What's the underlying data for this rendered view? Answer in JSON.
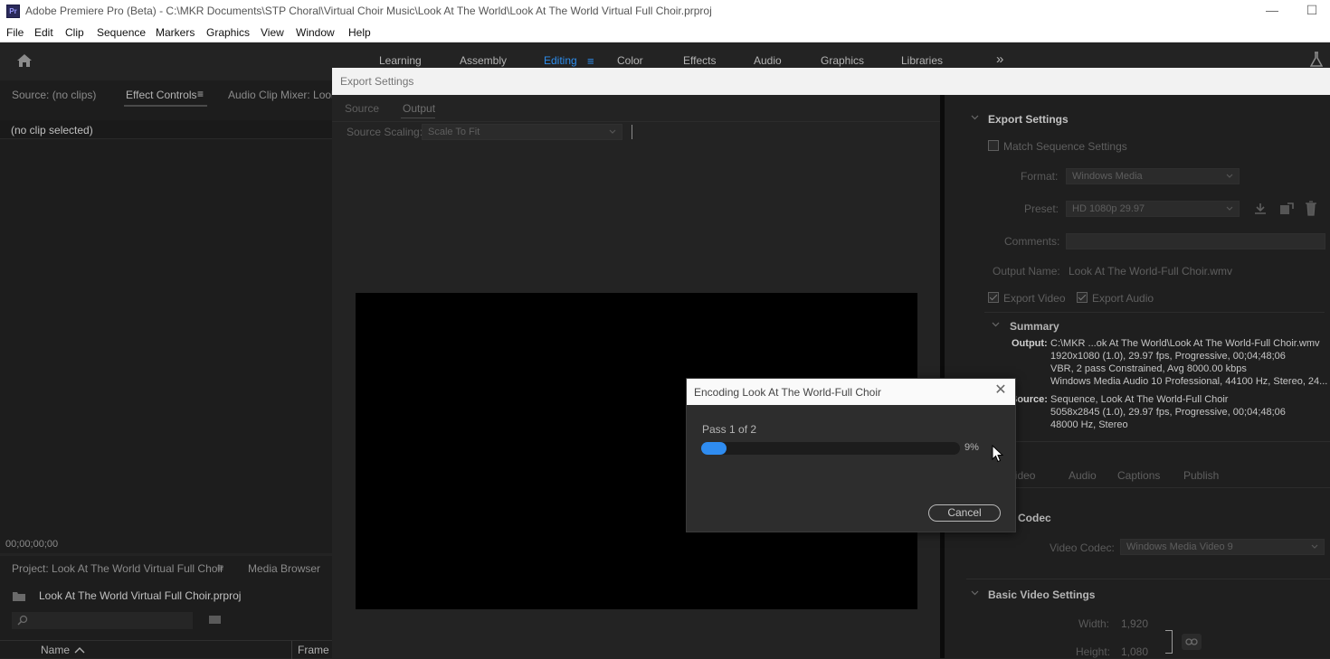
{
  "window": {
    "title": "Adobe Premiere Pro (Beta) - C:\\MKR Documents\\STP Choral\\Virtual Choir Music\\Look At The World\\Look At The World Virtual Full Choir.prproj",
    "app_icon": "Pr",
    "minimize": "—",
    "maximize": "☐"
  },
  "menu": [
    "File",
    "Edit",
    "Clip",
    "Sequence",
    "Markers",
    "Graphics",
    "View",
    "Window",
    "Help"
  ],
  "workspaces": {
    "items": [
      "Learning",
      "Assembly",
      "Editing",
      "Color",
      "Effects",
      "Audio",
      "Graphics",
      "Libraries"
    ],
    "active": "Editing",
    "menu_glyph": "≡",
    "overflow_glyph": "»"
  },
  "source_panel": {
    "tabs": [
      "Source: (no clips)",
      "Effect Controls",
      "Audio Clip Mixer: Look"
    ],
    "active_tab": "Effect Controls",
    "tab_menu_glyph": "≡",
    "no_clip": "(no clip selected)",
    "timecode": "00;00;00;00"
  },
  "project_panel": {
    "tabs": [
      "Project: Look At The World Virtual Full Choir",
      "Media Browser"
    ],
    "tab_menu_glyph": "≡",
    "file": "Look At The World Virtual Full Choir.prproj",
    "columns": [
      "Name",
      "Frame R"
    ]
  },
  "export_settings": {
    "title": "Export Settings",
    "tabs": [
      "Source",
      "Output"
    ],
    "active_tab": "Output",
    "source_scaling_label": "Source Scaling:",
    "source_scaling_value": "Scale To Fit",
    "section_title": "Export Settings",
    "match_sequence": "Match Sequence Settings",
    "format_label": "Format:",
    "format_value": "Windows Media",
    "preset_label": "Preset:",
    "preset_value": "HD 1080p 29.97",
    "comments_label": "Comments:",
    "output_name_label": "Output Name:",
    "output_name_value": "Look At The World-Full Choir.wmv",
    "export_video": "Export Video",
    "export_audio": "Export Audio",
    "summary_title": "Summary",
    "summary": {
      "output_label": "Output:",
      "output_lines": [
        "C:\\MKR ...ok At The World\\Look At The World-Full Choir.wmv",
        "1920x1080 (1.0), 29.97 fps, Progressive, 00;04;48;06",
        "VBR, 2 pass Constrained, Avg 8000.00 kbps",
        "Windows Media Audio 10 Professional, 44100 Hz, Stereo, 24..."
      ],
      "source_label": "Source:",
      "source_lines": [
        "Sequence, Look At The World-Full Choir",
        "5058x2845 (1.0), 29.97 fps, Progressive, 00;04;48;06",
        "48000 Hz, Stereo"
      ]
    },
    "lower_tabs": [
      "Video",
      "Audio",
      "Captions",
      "Publish"
    ],
    "codec_title": "Codec",
    "video_codec_label": "Video Codec:",
    "video_codec_value": "Windows Media Video 9",
    "basic_video_title": "Basic Video Settings",
    "width_label": "Width:",
    "width_value": "1,920",
    "height_label": "Height:",
    "height_value": "1,080"
  },
  "encoding": {
    "title": "Encoding Look At The World-Full Choir",
    "close_glyph": "✕",
    "pass": "Pass 1 of 2",
    "percent_text": "9%",
    "progress": 0.09,
    "cancel": "Cancel"
  },
  "colors": {
    "accent": "#2d8ceb",
    "progress": "#2f8cf0",
    "background": "#232323"
  }
}
